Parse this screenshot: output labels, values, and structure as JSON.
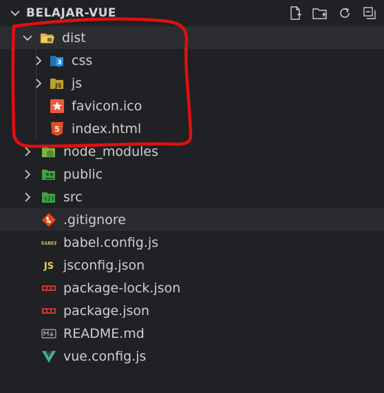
{
  "explorer": {
    "root_label": "BELAJAR-VUE",
    "actions": [
      {
        "name": "new-file"
      },
      {
        "name": "new-folder"
      },
      {
        "name": "refresh"
      },
      {
        "name": "collapse-all"
      }
    ],
    "items": [
      {
        "label": "dist",
        "kind": "folder-open",
        "depth": 0,
        "icon": "dist-folder-icon",
        "color": "#d9b54a"
      },
      {
        "label": "css",
        "kind": "folder",
        "depth": 1,
        "icon": "css-folder-icon",
        "color": "#2965f1"
      },
      {
        "label": "js",
        "kind": "folder",
        "depth": 1,
        "icon": "js-folder-icon",
        "color": "#d9c23a"
      },
      {
        "label": "favicon.ico",
        "kind": "file",
        "depth": 1,
        "icon": "favicon-star-icon",
        "color": "#f05a3c"
      },
      {
        "label": "index.html",
        "kind": "file",
        "depth": 1,
        "icon": "html5-icon",
        "color": "#e44d26"
      },
      {
        "label": "node_modules",
        "kind": "folder",
        "depth": 0,
        "icon": "node-folder-icon",
        "color": "#8bc34a"
      },
      {
        "label": "public",
        "kind": "folder",
        "depth": 0,
        "icon": "public-folder-icon",
        "color": "#4caf50"
      },
      {
        "label": "src",
        "kind": "folder",
        "depth": 0,
        "icon": "src-folder-icon",
        "color": "#4caf50"
      },
      {
        "label": ".gitignore",
        "kind": "file",
        "depth": 0,
        "icon": "git-icon",
        "color": "#e64a19"
      },
      {
        "label": "babel.config.js",
        "kind": "file",
        "depth": 0,
        "icon": "babel-icon",
        "color": "#f5da55"
      },
      {
        "label": "jsconfig.json",
        "kind": "file",
        "depth": 0,
        "icon": "js-icon",
        "color": "#f5da55"
      },
      {
        "label": "package-lock.json",
        "kind": "file",
        "depth": 0,
        "icon": "npm-icon",
        "color": "#cb3837"
      },
      {
        "label": "package.json",
        "kind": "file",
        "depth": 0,
        "icon": "npm-icon",
        "color": "#cb3837"
      },
      {
        "label": "README.md",
        "kind": "file",
        "depth": 0,
        "icon": "markdown-icon",
        "color": "#9e9e9e"
      },
      {
        "label": "vue.config.js",
        "kind": "file",
        "depth": 0,
        "icon": "vue-icon",
        "color": "#41b883"
      }
    ]
  },
  "colors": {
    "background": "#202124",
    "selected_row": "#2c2d31",
    "annotation": "#e01010"
  }
}
